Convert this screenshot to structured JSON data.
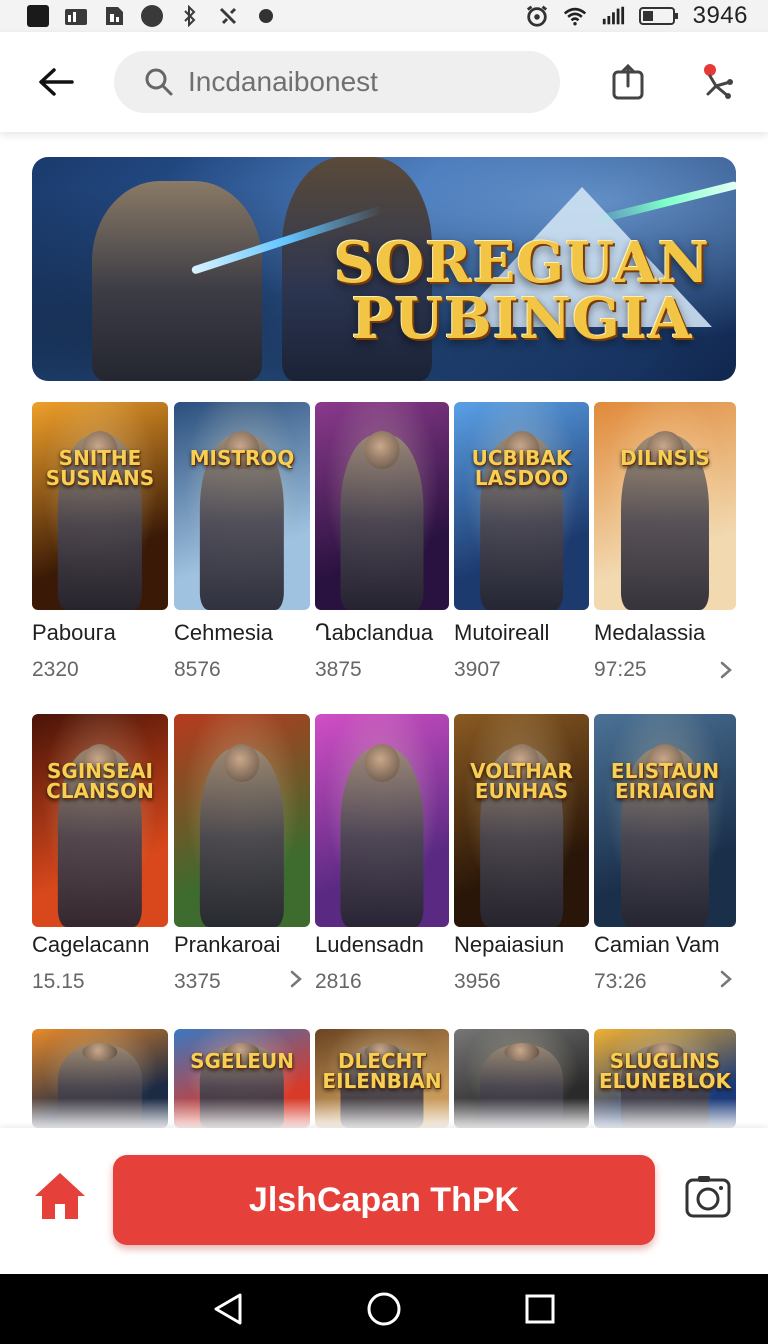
{
  "status_bar": {
    "time": "3946",
    "icons": [
      "app-icon",
      "signal-text-icon",
      "sim-icon",
      "blocked-icon",
      "bluetooth-icon",
      "nfc-icon",
      "dot-icon",
      "alarm-icon",
      "wifi-icon",
      "cell-signal-icon",
      "battery-icon"
    ]
  },
  "top_bar": {
    "search_placeholder": "Incdanaibonest",
    "icons": [
      "back-arrow-icon",
      "search-icon",
      "share-icon",
      "filter-icon"
    ]
  },
  "banner": {
    "title_line1": "SoreGuan",
    "title_line2": "Pubingia"
  },
  "games": {
    "row1": [
      {
        "title": "Pabouгa",
        "count": "2320",
        "art_text": "Snithe Susnans",
        "colors": [
          "#3a1a06",
          "#f0a02a"
        ]
      },
      {
        "title": "Cehmesia",
        "count": "8576",
        "art_text": "Mistroq",
        "colors": [
          "#9fc2e0",
          "#2b4f7d"
        ]
      },
      {
        "title": "Ղabclandua",
        "count": "3875",
        "art_text": "",
        "colors": [
          "#2a1240",
          "#8b3a8c"
        ]
      },
      {
        "title": "Mutoireall",
        "count": "3907",
        "art_text": "Ucbibak Lasdoo",
        "colors": [
          "#1d3a6e",
          "#5aa0e6"
        ]
      },
      {
        "title": "Medalassia",
        "count": "97:25",
        "art_text": "Dilnsis",
        "colors": [
          "#f2d9b0",
          "#e08a3a"
        ]
      }
    ],
    "row2": [
      {
        "title": "Cagelacann",
        "count": "15.15",
        "art_text": "Sginseai Clanson",
        "colors": [
          "#d8481c",
          "#4a1408"
        ]
      },
      {
        "title": "Prankaroai",
        "count": "3375",
        "art_text": "",
        "colors": [
          "#3e6b2e",
          "#b83a1e"
        ]
      },
      {
        "title": "Ludensadn",
        "count": "2816",
        "art_text": "",
        "colors": [
          "#5a2a82",
          "#d24fc6"
        ]
      },
      {
        "title": "Nepaiasiun",
        "count": "3956",
        "art_text": "Volthar Eunhas",
        "colors": [
          "#2a1608",
          "#8a5a22"
        ]
      },
      {
        "title": "Camian Vam",
        "count": "73:26",
        "art_text": "Elistaun Eiriaign",
        "colors": [
          "#1a2f4a",
          "#4b7296"
        ]
      }
    ],
    "row3": [
      {
        "art_text": "",
        "colors": [
          "#1c2a44",
          "#e88a2a"
        ]
      },
      {
        "art_text": "Sgeleun",
        "colors": [
          "#d83a2a",
          "#3a78c0"
        ]
      },
      {
        "art_text": "Dlecht Eilenbian",
        "colors": [
          "#c89a5a",
          "#6a4422"
        ]
      },
      {
        "art_text": "",
        "colors": [
          "#2a2a2a",
          "#777777"
        ]
      },
      {
        "art_text": "Sluglins Eluneblok",
        "colors": [
          "#1a3a7a",
          "#f0b030"
        ]
      }
    ]
  },
  "bottom_bar": {
    "cta_label": "JlshCapan ThPK",
    "icons": [
      "home-icon",
      "camera-icon"
    ],
    "accent": "#e5413a"
  },
  "nav_bar": {
    "icons": [
      "nav-back-icon",
      "nav-home-icon",
      "nav-recents-icon"
    ]
  }
}
